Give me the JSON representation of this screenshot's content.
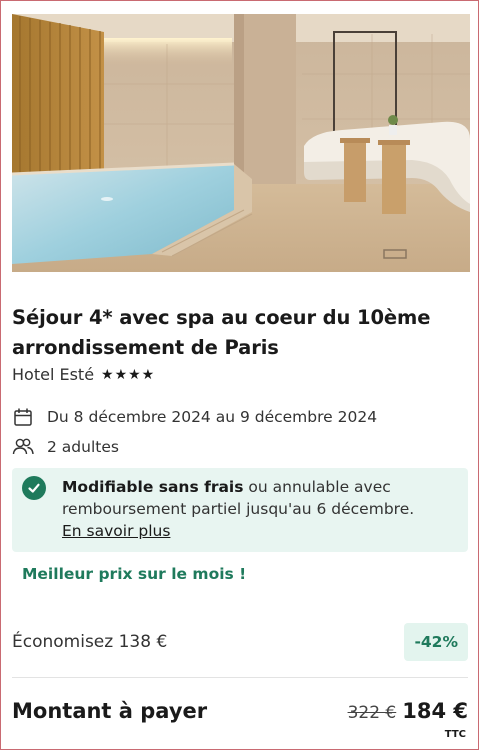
{
  "offer": {
    "title": "Séjour 4* avec spa au coeur du 10ème arrondissement de Paris",
    "hotel_name": "Hotel Esté",
    "stars": "★★★★",
    "star_count": 4
  },
  "details": {
    "dates": "Du 8 décembre 2024 au 9 décembre 2024",
    "guests": "2 adultes",
    "calendar_icon": "calendar-icon",
    "guests_icon": "users-icon"
  },
  "notice": {
    "bold_text": "Modifiable sans frais",
    "text": " ou annulable avec remboursement partiel jusqu'au 6 décembre.",
    "link_text": "En savoir plus",
    "icon": "check-circle-icon"
  },
  "best_price": "Meilleur prix sur le mois !",
  "savings": {
    "label": "Économisez 138 €",
    "badge": "-42%"
  },
  "payment": {
    "label": "Montant à payer",
    "old_price": "322 €",
    "new_price": "184 €",
    "tax_note": "TTC"
  },
  "colors": {
    "accent_green": "#1f7a5c",
    "notice_bg": "#e8f5f1",
    "badge_bg": "#e3f4ee"
  }
}
